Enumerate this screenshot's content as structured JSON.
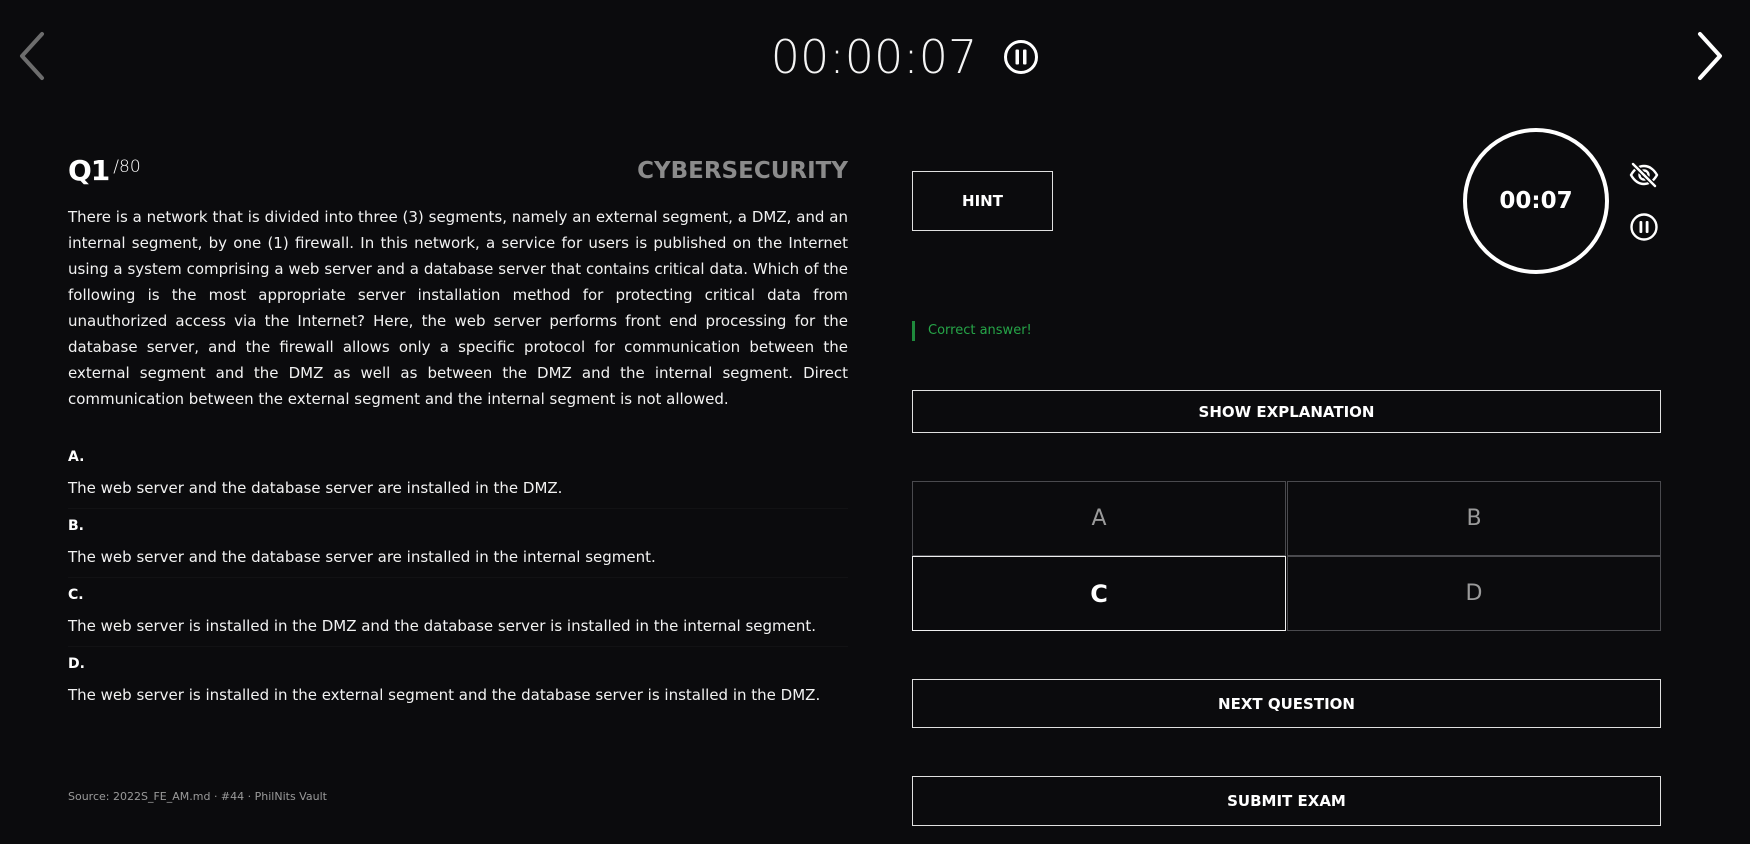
{
  "timer": {
    "elapsed": "00:00:07"
  },
  "question": {
    "number": "Q1",
    "total": "/80",
    "category": "CYBERSECURITY",
    "text": "There is a network that is divided into three (3) segments, namely an external segment, a DMZ, and an internal segment, by one (1) firewall. In this network, a service for users is published on the Internet using a system comprising a web server and a database server that contains critical data. Which of the following is the most appropriate server installation method for protecting critical data from unauthorized access via the Internet? Here, the web server performs front end processing for the database server, and the firewall allows only a specific protocol for communication between the external segment and the DMZ as well as between the DMZ and the internal segment. Direct communication between the external segment and the internal segment is not allowed."
  },
  "options": [
    {
      "letter": "A.",
      "text": "The web server and the database server are installed in the DMZ."
    },
    {
      "letter": "B.",
      "text": "The web server and the database server are installed in the internal segment."
    },
    {
      "letter": "C.",
      "text": "The web server is installed in the DMZ and the database server is installed in the internal segment."
    },
    {
      "letter": "D.",
      "text": "The web server is installed in the external segment and the database server is installed in the DMZ."
    }
  ],
  "source": "Source: 2022S_FE_AM.md · #44 · PhilNits Vault",
  "panel": {
    "hint_label": "HINT",
    "question_timer": "00:07",
    "feedback": "Correct answer!",
    "feedback_color": "#26a548",
    "explain_label": "SHOW EXPLANATION",
    "answers": [
      "A",
      "B",
      "C",
      "D"
    ],
    "selected": "C",
    "next_label": "NEXT QUESTION",
    "submit_label": "SUBMIT EXAM"
  },
  "icons": {
    "prev": "chevron-left-icon",
    "next": "chevron-right-icon",
    "pause": "pause-circle-icon",
    "hide": "eye-off-icon"
  }
}
